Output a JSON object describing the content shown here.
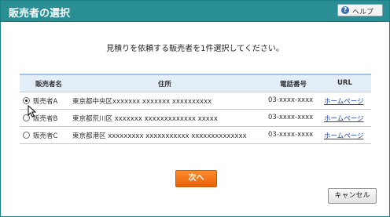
{
  "dialog": {
    "title": "販売者の選択",
    "help_label": "ヘルプ",
    "instruction": "見積りを依頼する販売者を1件選択してください。"
  },
  "table": {
    "headers": {
      "seller": "販売者名",
      "address": "住所",
      "phone": "電話番号",
      "url": "URL"
    },
    "rows": [
      {
        "seller": "販売者A",
        "address": "東京都中央区xxxxxxx xxxxxxx xxxxxxxxxx",
        "phone": "03-xxxx-xxxx",
        "url": "ホームページ",
        "selected": true
      },
      {
        "seller": "販売者B",
        "address": "東京都荒川区 xxxxxxx xxxxxxxxxxxxx xxxxx",
        "phone": "03-xxxx-xxxx",
        "url": "ホームページ",
        "selected": false
      },
      {
        "seller": "販売者C",
        "address": "東京都港区 xxxxxxxxx xxxxxxxxxxx xxxxxxxxxxxxxx",
        "phone": "03-xxxx-xxxx",
        "url": "ホームページ",
        "selected": false
      }
    ]
  },
  "buttons": {
    "next": "次へ",
    "cancel": "キャンセル"
  },
  "colors": {
    "titlebar": "#2a8f95",
    "header_row": "#e4eef8",
    "next_button": "#f07018",
    "link": "#1a43c8"
  },
  "icons": [
    "help-icon",
    "radio-icon",
    "mouse-cursor-icon"
  ]
}
